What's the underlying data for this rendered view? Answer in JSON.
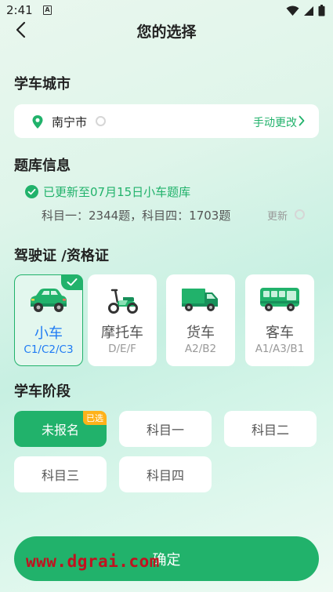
{
  "status_bar": {
    "time": "2:41",
    "notification_icon": "A"
  },
  "header": {
    "title": "您的选择"
  },
  "city_section": {
    "title": "学车城市",
    "city_name": "南宁市",
    "change_label": "手动更改"
  },
  "bank_section": {
    "title": "题库信息",
    "updated_text": "已更新至07月15日小车题库",
    "counts_text": "科目一：2344题，科目四：1703题",
    "refresh_label": "更新"
  },
  "license_section": {
    "title": "驾驶证 /资格证",
    "items": [
      {
        "name": "小车",
        "code": "C1/C2/C3",
        "selected": true
      },
      {
        "name": "摩托车",
        "code": "D/E/F",
        "selected": false
      },
      {
        "name": "货车",
        "code": "A2/B2",
        "selected": false
      },
      {
        "name": "客车",
        "code": "A1/A3/B1",
        "selected": false
      }
    ]
  },
  "stage_section": {
    "title": "学车阶段",
    "items": [
      {
        "label": "未报名",
        "selected": true,
        "badge": "已选"
      },
      {
        "label": "科目一",
        "selected": false
      },
      {
        "label": "科目二",
        "selected": false
      },
      {
        "label": "科目三",
        "selected": false
      },
      {
        "label": "科目四",
        "selected": false
      }
    ]
  },
  "confirm_label": "确定",
  "watermark": "www.dgrai.com",
  "colors": {
    "accent": "#21b26b",
    "selected_text": "#1f7bf4",
    "badge": "#ffb21a",
    "watermark": "#c0121f"
  }
}
